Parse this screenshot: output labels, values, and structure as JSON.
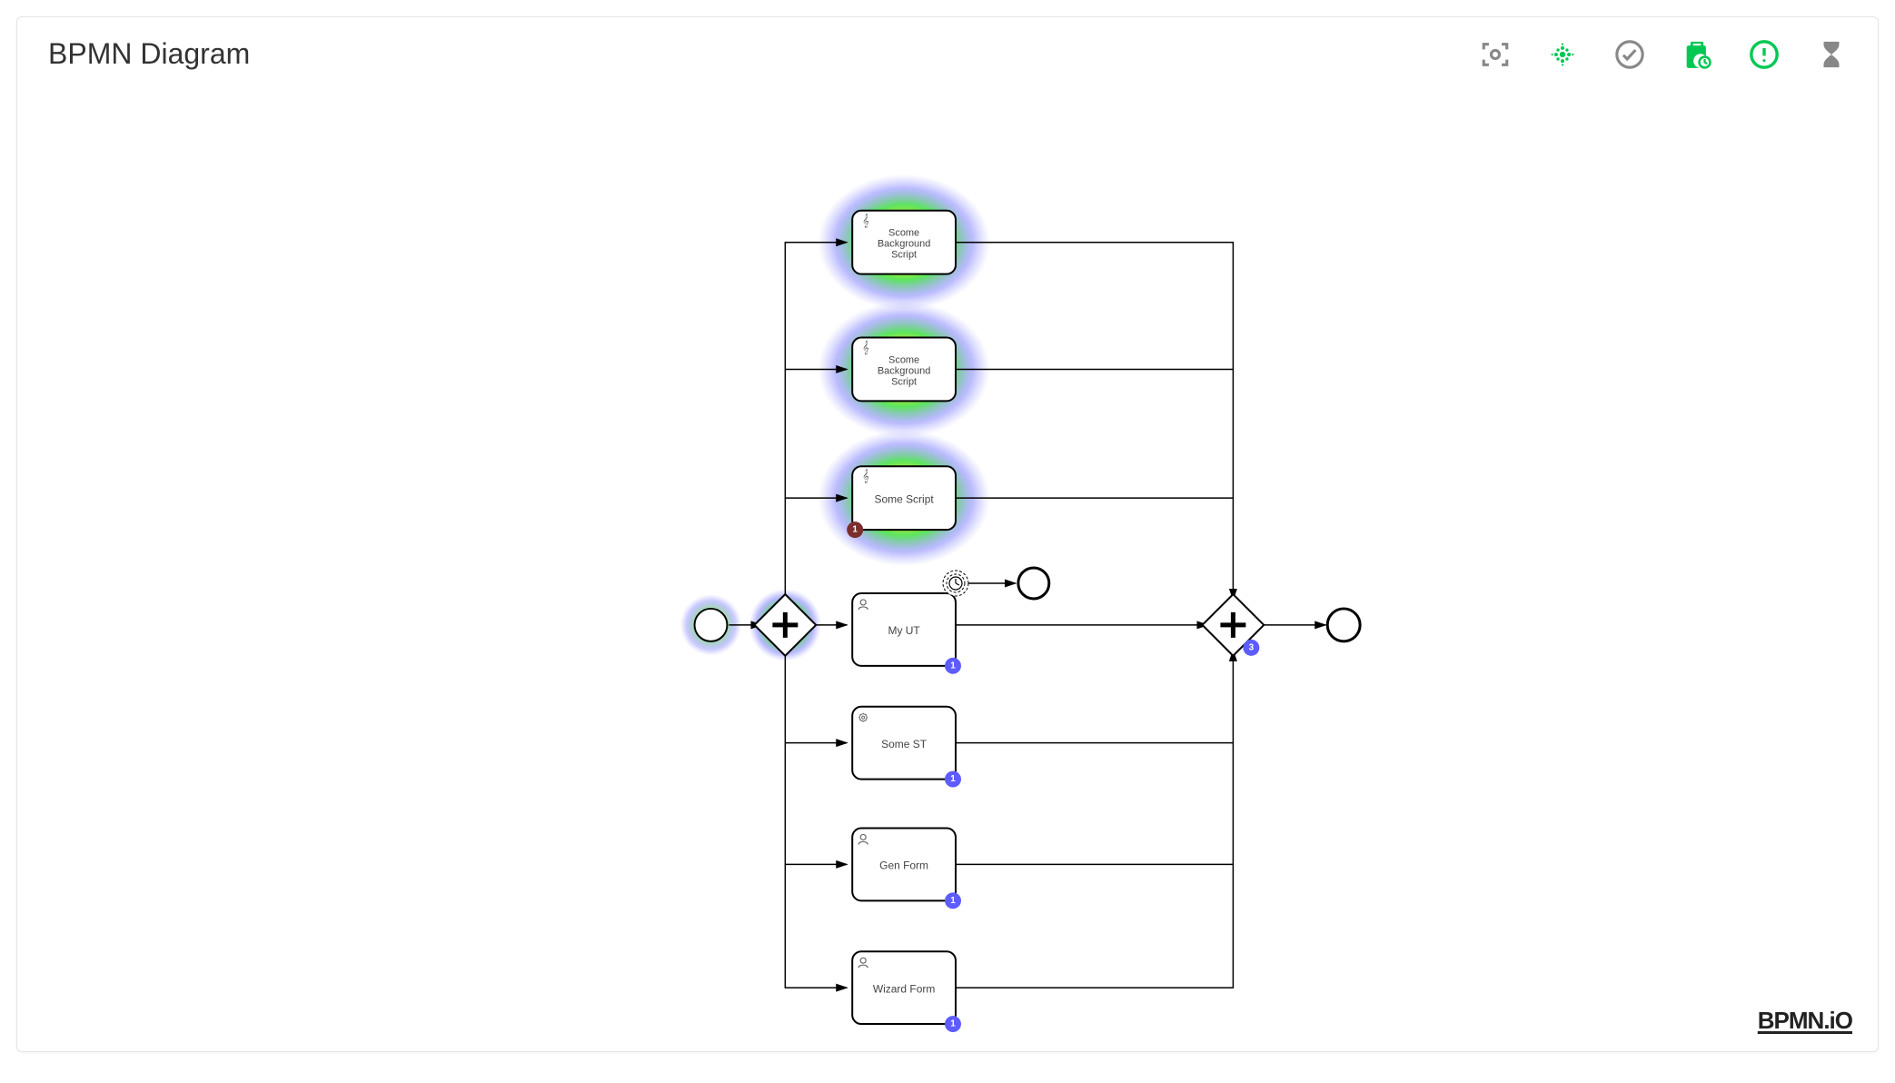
{
  "header": {
    "title": "BPMN Diagram",
    "logo": "BPMN.iO"
  },
  "toolbar": {
    "icons": [
      {
        "name": "fit-viewport-icon",
        "color": "gray"
      },
      {
        "name": "heatmap-icon",
        "color": "green"
      },
      {
        "name": "check-circle-icon",
        "color": "gray"
      },
      {
        "name": "clipboard-time-icon",
        "color": "green"
      },
      {
        "name": "alert-circle-icon",
        "color": "green"
      },
      {
        "name": "hourglass-icon",
        "color": "gray"
      }
    ]
  },
  "diagram": {
    "start_event": {
      "type": "none-start",
      "heat": "high"
    },
    "gateway_split": {
      "type": "parallel",
      "heat": "high"
    },
    "gateway_join": {
      "type": "parallel",
      "badge": "3"
    },
    "end_event_main": {
      "type": "none-end"
    },
    "end_event_timer_branch": {
      "type": "none-end"
    },
    "boundary_timer": {
      "attached_to": "My UT",
      "interrupting": false
    },
    "tasks": [
      {
        "id": "t1",
        "label": "Scome Background Script",
        "type": "script",
        "heat": "high",
        "badge": null
      },
      {
        "id": "t2",
        "label": "Scome Background Script",
        "type": "script",
        "heat": "high",
        "badge": null
      },
      {
        "id": "t3",
        "label": "Some Script",
        "type": "script",
        "heat": "high",
        "badge": "1",
        "badge_color": "maroon"
      },
      {
        "id": "t4",
        "label": "My UT",
        "type": "user",
        "heat": "low",
        "badge": "1"
      },
      {
        "id": "t5",
        "label": "Some ST",
        "type": "service",
        "heat": null,
        "badge": "1"
      },
      {
        "id": "t6",
        "label": "Gen Form",
        "type": "user",
        "heat": null,
        "badge": "1"
      },
      {
        "id": "t7",
        "label": "Wizard Form",
        "type": "user",
        "heat": null,
        "badge": "1"
      }
    ]
  }
}
